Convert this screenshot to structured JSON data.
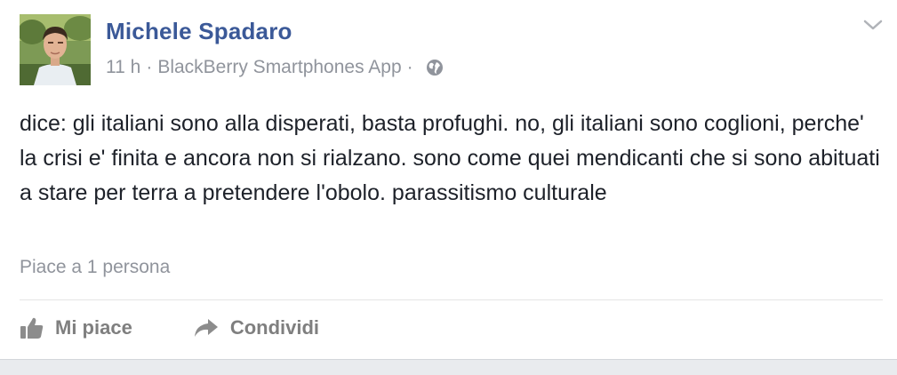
{
  "post": {
    "author": "Michele Spadaro",
    "time": "11 h",
    "separator": "·",
    "source": "BlackBerry Smartphones App",
    "audience_icon": "globe-icon",
    "menu_icon": "chevron-down-icon",
    "text": "dice: gli italiani sono alla disperati, basta profughi. no, gli italiani sono coglioni, perche' la crisi e' finita e ancora non si rialzano. sono come quei mendicanti che si sono abituati a stare per terra a pretendere l'obolo. parassitismo culturale",
    "likes_text": "Piace a 1 persona"
  },
  "actions": {
    "like_label": "Mi piace",
    "like_icon": "thumbs-up-icon",
    "share_label": "Condividi",
    "share_icon": "share-arrow-icon"
  },
  "colors": {
    "author": "#3b5998",
    "meta": "#90949c",
    "text": "#1d2129",
    "action": "#7f7f7f"
  }
}
